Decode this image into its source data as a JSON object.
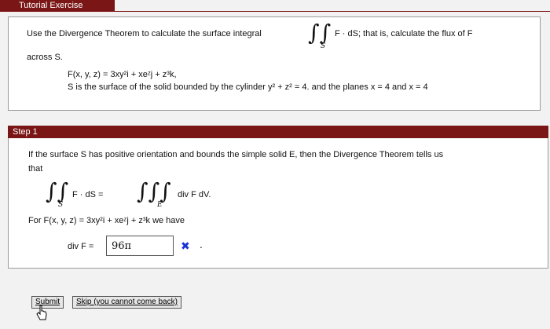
{
  "header": {
    "tab_label": "Tutorial Exercise"
  },
  "problem": {
    "line1_pre": "Use the Divergence Theorem to calculate the surface integral",
    "line1_post": "F · dS;  that is, calculate the flux of F",
    "line2": "across S.",
    "field": "F(x, y, z)  =  3xy²i  +  xeᶻj  +  z³k,",
    "surface_a": "S is the surface of the solid bounded by the cylinder  y²  +  z²  =  4.  and the planes  x = 4 and x = 4",
    "integral_sub": "S"
  },
  "step": {
    "title": "Step 1",
    "text1": "If the surface S has positive orientation and bounds the simple solid E, then the Divergence Theorem tells us",
    "text2": "that",
    "lhs": "F · dS  =",
    "rhs": "div F dV.",
    "sub_s": "S",
    "sub_e": "E",
    "text3": "For  F(x, y, z)  =  3xy²i  +  xeᶻj  +  z³k  we have",
    "div_label": "div F  =",
    "answer_value": "96π",
    "wrong_mark": "✖",
    "period": "."
  },
  "buttons": {
    "submit": "Submit",
    "skip": "Skip (you cannot come back)"
  }
}
